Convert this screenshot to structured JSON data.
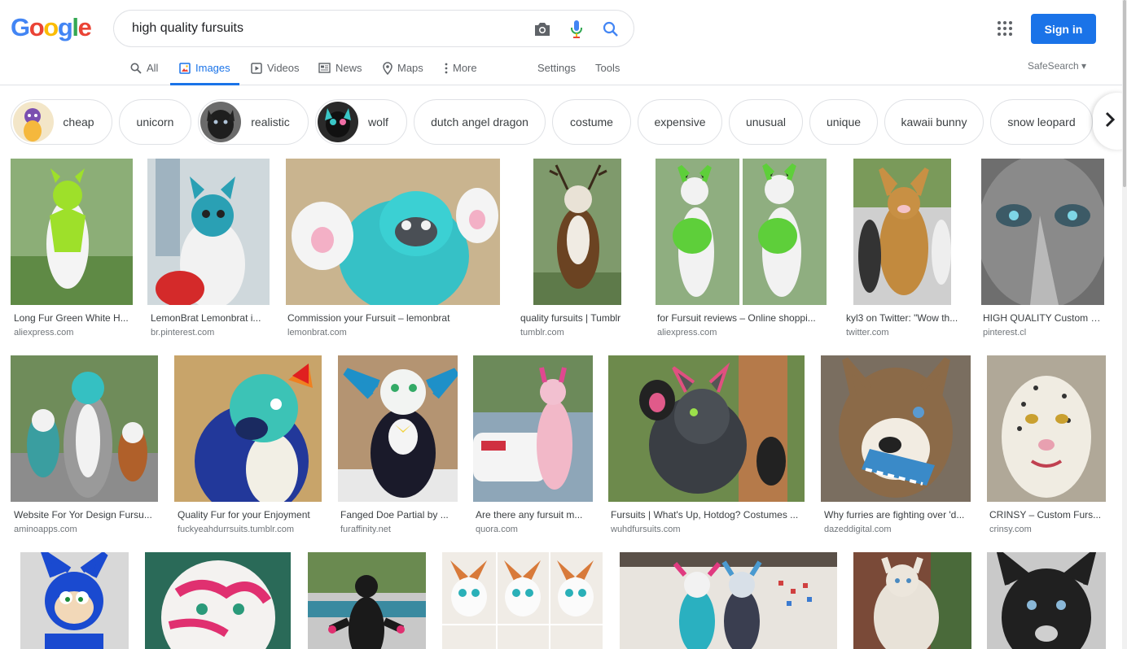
{
  "logo": {
    "letters": [
      "G",
      "o",
      "o",
      "g",
      "l",
      "e"
    ],
    "colors": [
      "#4285F4",
      "#EA4335",
      "#FBBC05",
      "#4285F4",
      "#34A853",
      "#EA4335"
    ]
  },
  "search": {
    "query": "high quality fursuits",
    "icons": [
      "camera-icon",
      "microphone-icon",
      "search-icon"
    ]
  },
  "header": {
    "signin_label": "Sign in",
    "apps_icon": "apps-grid-icon",
    "accent": "#1a73e8"
  },
  "tabs": [
    {
      "label": "All",
      "icon": "search-icon"
    },
    {
      "label": "Images",
      "icon": "image-icon",
      "active": true
    },
    {
      "label": "Videos",
      "icon": "play-icon"
    },
    {
      "label": "News",
      "icon": "news-icon"
    },
    {
      "label": "Maps",
      "icon": "map-pin-icon"
    },
    {
      "label": "More",
      "icon": "kebab-icon"
    },
    {
      "label": "Settings"
    },
    {
      "label": "Tools"
    }
  ],
  "safesearch": "SafeSearch ▾",
  "chips": [
    {
      "label": "cheap",
      "has_thumb": true
    },
    {
      "label": "unicorn"
    },
    {
      "label": "realistic",
      "has_thumb": true
    },
    {
      "label": "wolf",
      "has_thumb": true
    },
    {
      "label": "dutch angel dragon"
    },
    {
      "label": "costume"
    },
    {
      "label": "expensive"
    },
    {
      "label": "unusual"
    },
    {
      "label": "unique"
    },
    {
      "label": "kawaii bunny"
    },
    {
      "label": "snow leopard"
    }
  ],
  "results": [
    {
      "title": "Long Fur Green White H...",
      "source": "aliexpress.com"
    },
    {
      "title": "LemonBrat Lemonbrat i...",
      "source": "br.pinterest.com"
    },
    {
      "title": "Commission your Fursuit – lemonbrat",
      "source": "lemonbrat.com"
    },
    {
      "title": "quality fursuits | Tumblr",
      "source": "tumblr.com"
    },
    {
      "title": "for Fursuit reviews – Online shoppi...",
      "source": "aliexpress.com"
    },
    {
      "title": "kyl3 on Twitter: \"Wow th...",
      "source": "twitter.com"
    },
    {
      "title": "HIGH QUALITY Custom P...",
      "source": "pinterest.cl"
    },
    {
      "title": "Website For Yor Design Fursu...",
      "source": "aminoapps.com"
    },
    {
      "title": "Quality Fur for your Enjoyment",
      "source": "fuckyeahdurrsuits.tumblr.com"
    },
    {
      "title": "Fanged Doe Partial by ...",
      "source": "furaffinity.net"
    },
    {
      "title": "Are there any fursuit m...",
      "source": "quora.com"
    },
    {
      "title": "Fursuits | What's Up, Hotdog? Costumes ...",
      "source": "wuhdfursuits.com"
    },
    {
      "title": "Why furries are fighting over 'd...",
      "source": "dazeddigital.com"
    },
    {
      "title": "CRINSY – Custom Furs...",
      "source": "crinsy.com"
    },
    {
      "title": "",
      "source": ""
    },
    {
      "title": "",
      "source": ""
    },
    {
      "title": "",
      "source": ""
    },
    {
      "title": "",
      "source": ""
    },
    {
      "title": "",
      "source": ""
    },
    {
      "title": "",
      "source": ""
    },
    {
      "title": "",
      "source": ""
    }
  ]
}
